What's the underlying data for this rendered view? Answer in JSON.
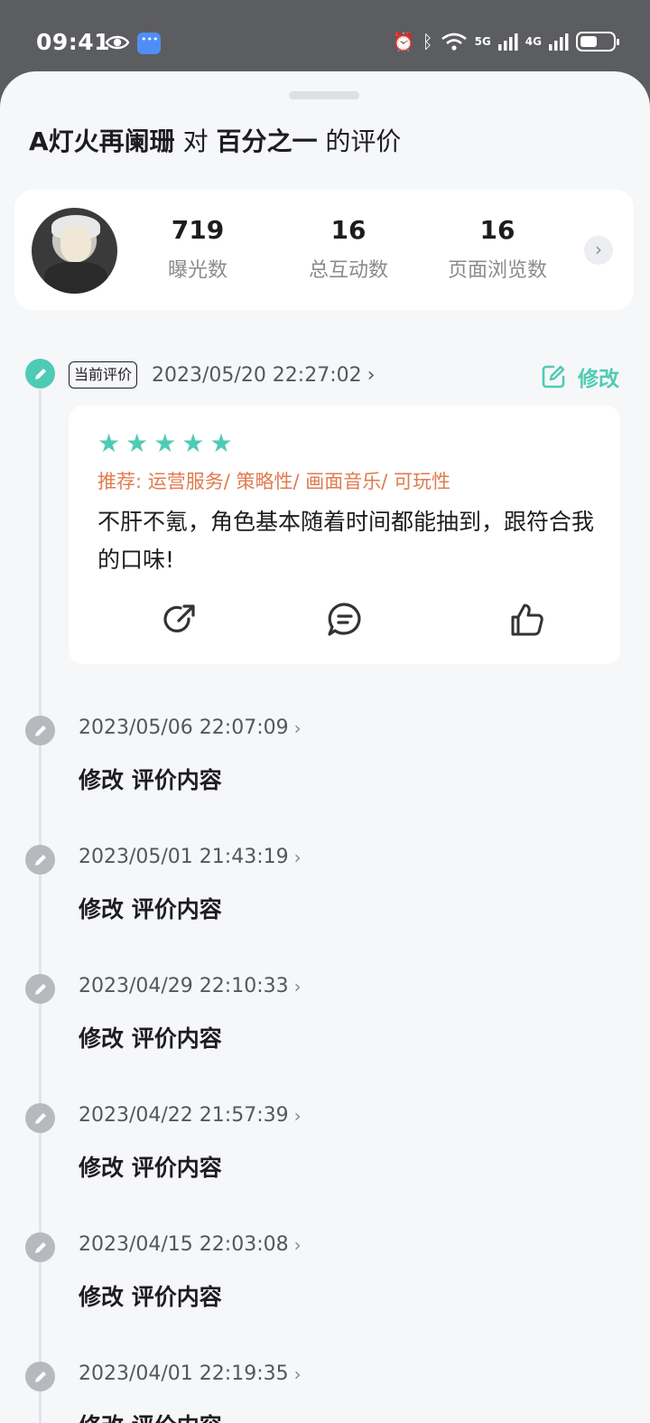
{
  "status_bar": {
    "time": "09:41",
    "net_5g": "5G",
    "net_4g": "4G"
  },
  "header": {
    "user": "A灯火再阑珊",
    "connector": "对",
    "game": "百分之一",
    "suffix": "的评价"
  },
  "stats": [
    {
      "value": "719",
      "label": "曝光数"
    },
    {
      "value": "16",
      "label": "总互动数"
    },
    {
      "value": "16",
      "label": "页面浏览数"
    }
  ],
  "current_review": {
    "tag": "当前评价",
    "date": "2023/05/20 22:27:02",
    "edit_label": "修改",
    "stars": 5,
    "recommend": "推荐: 运营服务/ 策略性/ 画面音乐/ 可玩性",
    "text": "不肝不氪，角色基本随着时间都能抽到，跟符合我的口味!"
  },
  "history": [
    {
      "date": "2023/05/06 22:07:09",
      "title": "修改 评价内容"
    },
    {
      "date": "2023/05/01 21:43:19",
      "title": "修改 评价内容"
    },
    {
      "date": "2023/04/29 22:10:33",
      "title": "修改 评价内容"
    },
    {
      "date": "2023/04/22 21:57:39",
      "title": "修改 评价内容"
    },
    {
      "date": "2023/04/15 22:03:08",
      "title": "修改 评价内容"
    },
    {
      "date": "2023/04/01 22:19:35",
      "title": "修改 评价内容"
    }
  ],
  "colors": {
    "accent": "#4fcbb5",
    "tag_orange": "#e07b4f",
    "node_gray": "#b7b9be"
  }
}
